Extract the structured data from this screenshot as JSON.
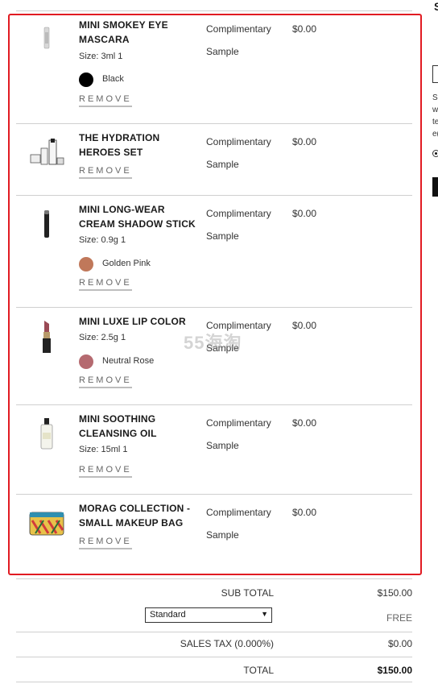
{
  "cart": {
    "items": [
      {
        "name": "MINI SMOKEY EYE MASCARA",
        "size": "Size: 3ml 1",
        "shade": "Black",
        "swatch": "#000000",
        "desc1": "Complimentary",
        "desc2": "Sample",
        "price": "$0.00",
        "remove": "REMOVE",
        "icon": "mascara-icon"
      },
      {
        "name": "THE HYDRATION HEROES SET",
        "size": "",
        "shade": "",
        "swatch": "",
        "desc1": "Complimentary",
        "desc2": "Sample",
        "price": "$0.00",
        "remove": "REMOVE",
        "icon": "skincare-set-icon"
      },
      {
        "name": "MINI LONG-WEAR CREAM SHADOW STICK",
        "size": "Size: 0.9g 1",
        "shade": "Golden Pink",
        "swatch": "#c0785a",
        "desc1": "Complimentary",
        "desc2": "Sample",
        "price": "$0.00",
        "remove": "REMOVE",
        "icon": "shadow-stick-icon"
      },
      {
        "name": "MINI LUXE LIP COLOR",
        "size": "Size: 2.5g 1",
        "shade": "Neutral Rose",
        "swatch": "#b56a70",
        "desc1": "Complimentary",
        "desc2": "Sample",
        "price": "$0.00",
        "remove": "REMOVE",
        "icon": "lipstick-icon"
      },
      {
        "name": "MINI SOOTHING CLEANSING OIL",
        "size": "Size: 15ml 1",
        "shade": "",
        "swatch": "",
        "desc1": "Complimentary",
        "desc2": "Sample",
        "price": "$0.00",
        "remove": "REMOVE",
        "icon": "cleansing-oil-icon"
      },
      {
        "name": "MORAG COLLECTION - SMALL MAKEUP BAG",
        "size": "",
        "shade": "",
        "swatch": "",
        "desc1": "Complimentary",
        "desc2": "Sample",
        "price": "$0.00",
        "remove": "REMOVE",
        "icon": "makeup-bag-icon"
      }
    ]
  },
  "summary": {
    "subtotal_label": "SUB TOTAL",
    "subtotal_value": "$150.00",
    "shipping_option": "Standard",
    "shipping_value": "FREE",
    "tax_label": "SALES TAX (0.000%)",
    "tax_value": "$0.00",
    "total_label": "TOTAL",
    "total_value": "$150.00"
  },
  "watermark": "55海淘",
  "side_panel": {
    "heading": "S",
    "lines": [
      "Sl",
      "w",
      "te",
      "e("
    ]
  },
  "colors": {
    "highlight": "#e11b22",
    "divider": "#cfcfcf"
  }
}
